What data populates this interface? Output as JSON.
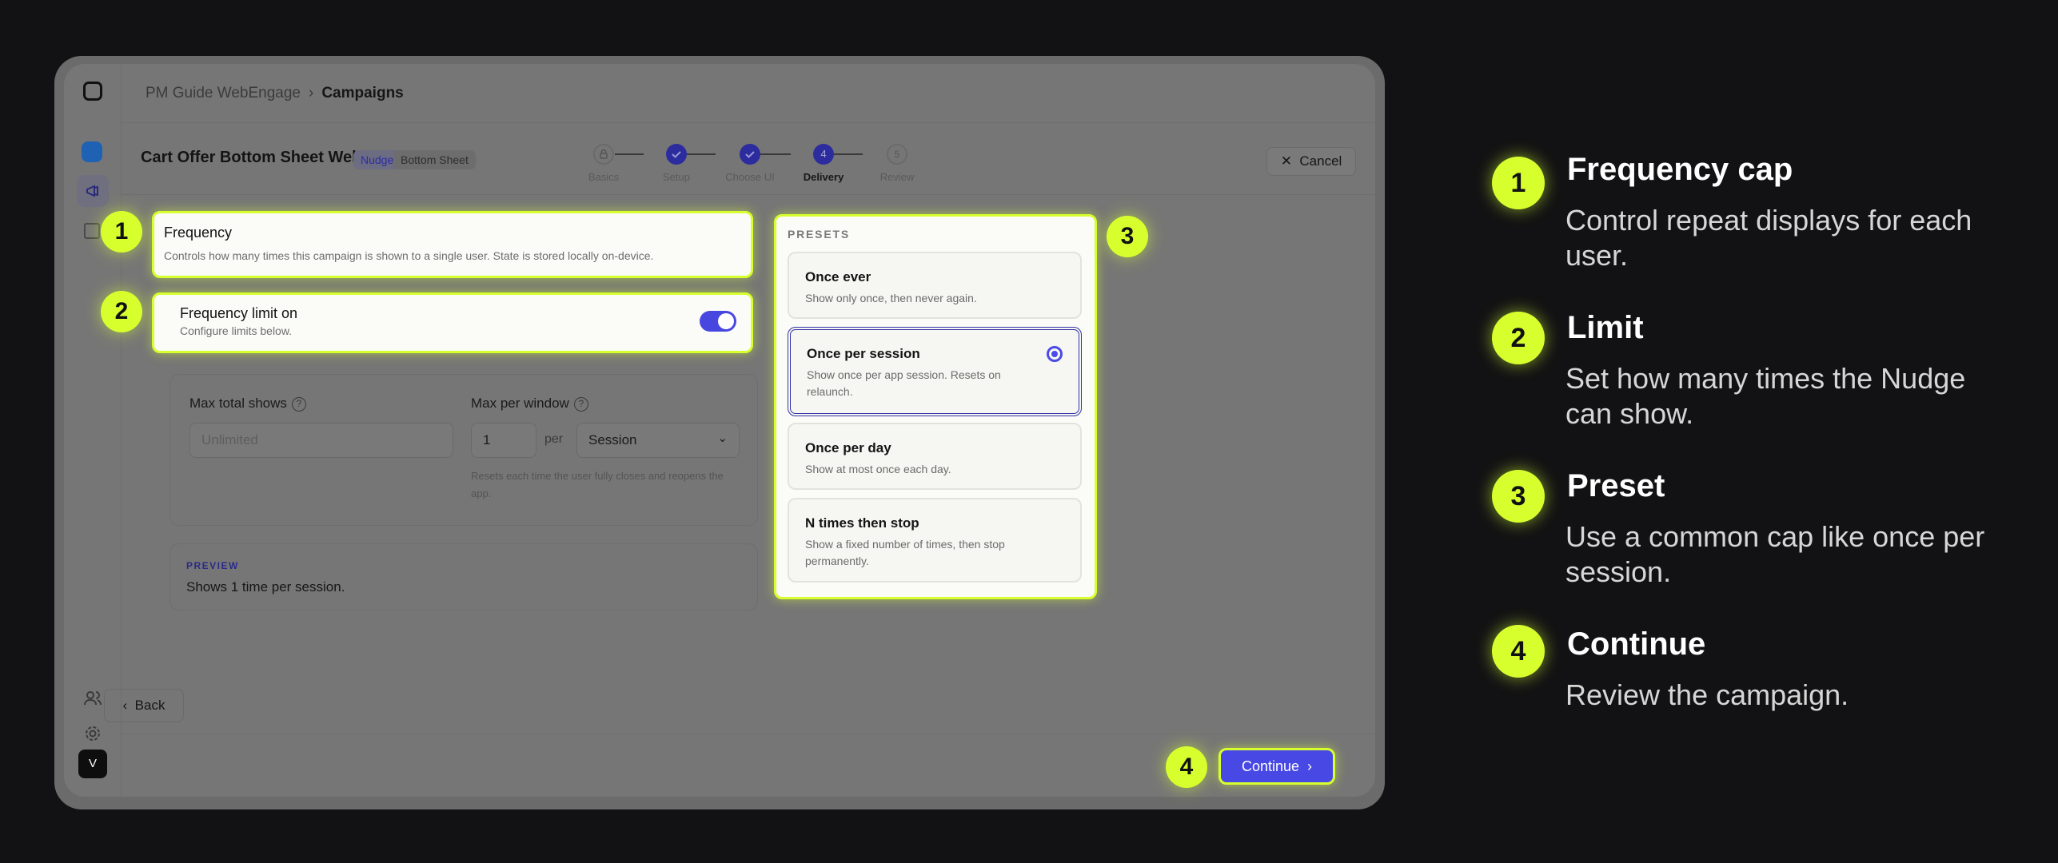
{
  "breadcrumb": {
    "parent": "PM Guide WebEngage",
    "current": "Campaigns"
  },
  "campaign": {
    "title": "Cart Offer Bottom Sheet Web...",
    "tag_type": "Nudge",
    "tag_format": "Bottom Sheet"
  },
  "steps": [
    {
      "label": "Basics",
      "number": ""
    },
    {
      "label": "Setup",
      "number": ""
    },
    {
      "label": "Choose UI",
      "number": ""
    },
    {
      "label": "Delivery",
      "number": "4"
    },
    {
      "label": "Review",
      "number": "5"
    }
  ],
  "cancel_label": "Cancel",
  "frequency": {
    "title": "Frequency",
    "description": "Controls how many times this campaign is shown to a single user. State is stored locally on-device."
  },
  "limit": {
    "title": "Frequency limit on",
    "description": "Configure limits below.",
    "enabled": true
  },
  "limits": {
    "max_total_label": "Max total shows",
    "max_total_placeholder": "Unlimited",
    "max_window_label": "Max per window",
    "max_window_value": "1",
    "per_label": "per",
    "window_unit": "Session",
    "hint": "Resets each time the user fully closes and reopens the app."
  },
  "preview": {
    "label": "PREVIEW",
    "text": "Shows 1 time per session."
  },
  "presets": {
    "title": "PRESETS",
    "options": [
      {
        "title": "Once ever",
        "description": "Show only once, then never again."
      },
      {
        "title": "Once per session",
        "description": "Show once per app session. Resets on relaunch."
      },
      {
        "title": "Once per day",
        "description": "Show at most once each day."
      },
      {
        "title": "N times then stop",
        "description": "Show a fixed number of times, then stop permanently."
      }
    ]
  },
  "footer": {
    "back_label": "Back",
    "continue_label": "Continue"
  },
  "avatar_initial": "V",
  "legend": [
    {
      "number": "1",
      "title": "Frequency cap",
      "description": "Control repeat displays for each user."
    },
    {
      "number": "2",
      "title": "Limit",
      "description": "Set how many times the Nudge can show."
    },
    {
      "number": "3",
      "title": "Preset",
      "description": "Use a common cap like once per session."
    },
    {
      "number": "4",
      "title": "Continue",
      "description": "Review the campaign."
    }
  ],
  "colors": {
    "highlight": "#d7ff2e",
    "accent": "#4848e4",
    "background": "#121214"
  }
}
